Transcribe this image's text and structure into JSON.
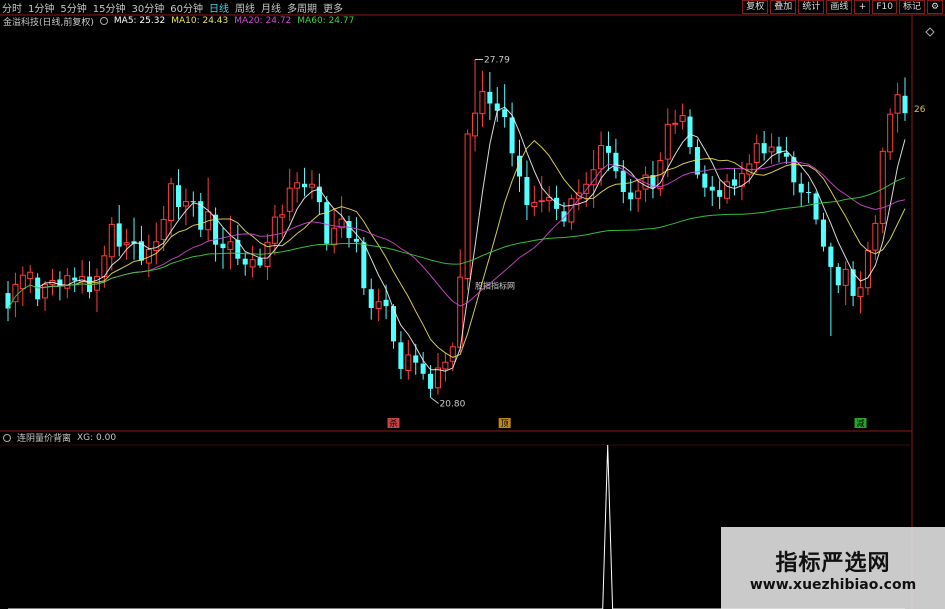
{
  "toolbar": {
    "tabs": [
      {
        "label": "分时",
        "active": false
      },
      {
        "label": "1分钟",
        "active": false
      },
      {
        "label": "5分钟",
        "active": false
      },
      {
        "label": "15分钟",
        "active": false
      },
      {
        "label": "30分钟",
        "active": false
      },
      {
        "label": "60分钟",
        "active": false
      },
      {
        "label": "日线",
        "active": true
      },
      {
        "label": "周线",
        "active": false
      },
      {
        "label": "月线",
        "active": false
      },
      {
        "label": "多周期",
        "active": false
      },
      {
        "label": "更多",
        "active": false
      }
    ],
    "tools": [
      "复权",
      "叠加",
      "统计",
      "画线",
      "F10",
      "标记"
    ],
    "icon_tools": [
      "plus-icon",
      "settings-icon"
    ]
  },
  "legend": {
    "title": "金溢科技(日线,前复权)",
    "ma5": "MA5: 25.32",
    "ma10": "MA10: 24.43",
    "ma20": "MA20: 24.72",
    "ma60": "MA60: 24.77"
  },
  "indicator": {
    "title": "连阴量价背离",
    "value": "XG: 0.00"
  },
  "watermark": {
    "cn": "指标严选网",
    "url": "www.xuezhibiao.com"
  },
  "colors": {
    "up": "#ff3b3b",
    "down": "#54ffff",
    "ma5": "#ffffff",
    "ma10": "#e8e05a",
    "ma20": "#d048d0",
    "ma60": "#3cd23c",
    "xg": "#ffffff"
  },
  "chart_data": {
    "type": "candlestick",
    "y_range": [
      20.5,
      28.4
    ],
    "high_label": "27.79",
    "low_label": "20.80",
    "right_price_label": "26",
    "annotation": "股指指标网",
    "markers": [
      {
        "index": 52,
        "label": "杀",
        "color": "#e05050"
      },
      {
        "index": 67,
        "label": "顶",
        "color": "#e0a020"
      },
      {
        "index": 115,
        "label": "减",
        "color": "#30c030"
      }
    ],
    "ohlc": [
      [
        22.96,
        23.21,
        22.38,
        22.64
      ],
      [
        22.78,
        23.38,
        22.46,
        23.14
      ],
      [
        23.05,
        23.51,
        22.69,
        23.33
      ],
      [
        23.26,
        23.54,
        22.96,
        23.39
      ],
      [
        23.28,
        23.37,
        22.69,
        22.83
      ],
      [
        22.86,
        23.21,
        22.59,
        23.14
      ],
      [
        23.14,
        23.46,
        22.91,
        23.22
      ],
      [
        23.24,
        23.41,
        22.81,
        23.1
      ],
      [
        23.06,
        23.48,
        22.85,
        23.32
      ],
      [
        23.28,
        23.49,
        22.98,
        23.22
      ],
      [
        23.2,
        23.64,
        22.95,
        23.3
      ],
      [
        23.3,
        23.62,
        22.85,
        22.98
      ],
      [
        23.02,
        23.47,
        22.57,
        23.3
      ],
      [
        23.3,
        23.94,
        23.07,
        23.73
      ],
      [
        23.71,
        24.53,
        23.43,
        24.38
      ],
      [
        24.4,
        24.78,
        23.72,
        23.92
      ],
      [
        23.96,
        24.29,
        23.65,
        24.0
      ],
      [
        24.03,
        24.52,
        23.65,
        23.98
      ],
      [
        24.03,
        24.35,
        23.54,
        23.63
      ],
      [
        23.58,
        24.17,
        23.29,
        23.86
      ],
      [
        23.84,
        24.42,
        23.55,
        24.02
      ],
      [
        24.07,
        24.76,
        23.83,
        24.48
      ],
      [
        24.46,
        25.35,
        24.14,
        25.22
      ],
      [
        25.19,
        25.52,
        24.49,
        24.74
      ],
      [
        24.76,
        25.12,
        24.36,
        24.85
      ],
      [
        24.86,
        25.06,
        24.54,
        24.84
      ],
      [
        24.86,
        25.03,
        24.12,
        24.27
      ],
      [
        24.27,
        25.35,
        24.04,
        24.64
      ],
      [
        24.58,
        24.73,
        23.61,
        23.96
      ],
      [
        23.98,
        24.31,
        23.46,
        23.89
      ],
      [
        23.86,
        24.56,
        23.45,
        24.02
      ],
      [
        24.06,
        24.37,
        23.54,
        23.67
      ],
      [
        23.67,
        23.8,
        23.32,
        23.55
      ],
      [
        23.5,
        23.94,
        23.28,
        23.65
      ],
      [
        23.68,
        23.88,
        23.48,
        23.53
      ],
      [
        23.51,
        24.18,
        23.23,
        24.01
      ],
      [
        23.99,
        24.78,
        23.75,
        24.53
      ],
      [
        24.53,
        24.79,
        24.11,
        24.58
      ],
      [
        24.65,
        25.53,
        24.45,
        25.13
      ],
      [
        25.13,
        25.46,
        24.83,
        25.24
      ],
      [
        25.22,
        25.55,
        24.96,
        25.15
      ],
      [
        25.15,
        25.5,
        24.9,
        25.21
      ],
      [
        25.16,
        25.43,
        24.58,
        24.84
      ],
      [
        24.84,
        24.97,
        23.84,
        23.98
      ],
      [
        23.96,
        24.72,
        23.78,
        24.3
      ],
      [
        24.31,
        24.96,
        24.1,
        24.49
      ],
      [
        24.45,
        24.56,
        23.9,
        24.1
      ],
      [
        24.08,
        24.53,
        23.8,
        24.02
      ],
      [
        24.01,
        24.12,
        22.92,
        23.06
      ],
      [
        23.04,
        23.26,
        22.41,
        22.65
      ],
      [
        22.64,
        23.05,
        22.38,
        22.78
      ],
      [
        22.82,
        23.13,
        22.42,
        22.69
      ],
      [
        22.69,
        22.73,
        21.81,
        21.96
      ],
      [
        21.94,
        22.17,
        21.18,
        21.39
      ],
      [
        21.36,
        21.99,
        21.17,
        21.68
      ],
      [
        21.67,
        21.91,
        21.27,
        21.52
      ],
      [
        21.5,
        21.74,
        21.17,
        21.29
      ],
      [
        21.29,
        21.47,
        20.8,
        20.98
      ],
      [
        21.0,
        21.72,
        20.86,
        21.41
      ],
      [
        21.39,
        21.72,
        21.13,
        21.53
      ],
      [
        21.55,
        21.94,
        21.34,
        21.85
      ],
      [
        21.84,
        23.86,
        21.73,
        23.29
      ],
      [
        23.26,
        26.34,
        23.02,
        26.25
      ],
      [
        26.21,
        27.79,
        25.89,
        26.68
      ],
      [
        26.67,
        27.56,
        26.39,
        27.13
      ],
      [
        27.12,
        27.53,
        26.54,
        26.88
      ],
      [
        26.88,
        27.22,
        26.5,
        26.73
      ],
      [
        26.76,
        27.28,
        26.38,
        26.6
      ],
      [
        26.59,
        26.9,
        25.58,
        25.85
      ],
      [
        25.8,
        26.13,
        25.05,
        25.37
      ],
      [
        25.36,
        25.7,
        24.47,
        24.78
      ],
      [
        24.75,
        25.18,
        24.55,
        24.83
      ],
      [
        24.85,
        25.38,
        24.63,
        24.87
      ],
      [
        24.87,
        25.17,
        24.64,
        24.94
      ],
      [
        24.93,
        25.18,
        24.47,
        24.7
      ],
      [
        24.65,
        24.84,
        24.33,
        24.44
      ],
      [
        24.43,
        25.0,
        24.27,
        24.91
      ],
      [
        24.91,
        25.31,
        24.67,
        25.03
      ],
      [
        25.02,
        25.46,
        24.74,
        25.21
      ],
      [
        25.2,
        25.92,
        24.72,
        25.51
      ],
      [
        25.53,
        26.3,
        25.18,
        26.01
      ],
      [
        26.0,
        26.3,
        25.49,
        25.86
      ],
      [
        25.86,
        26.15,
        25.33,
        25.48
      ],
      [
        25.49,
        25.71,
        24.82,
        25.05
      ],
      [
        25.04,
        25.32,
        24.66,
        24.9
      ],
      [
        24.92,
        25.31,
        24.64,
        25.07
      ],
      [
        25.11,
        25.58,
        24.84,
        25.4
      ],
      [
        25.4,
        25.69,
        24.92,
        25.14
      ],
      [
        25.12,
        25.87,
        24.97,
        25.7
      ],
      [
        25.73,
        26.78,
        25.35,
        26.45
      ],
      [
        26.46,
        26.75,
        26.25,
        26.47
      ],
      [
        26.51,
        26.88,
        26.34,
        26.63
      ],
      [
        26.61,
        26.76,
        25.83,
        25.98
      ],
      [
        25.98,
        26.14,
        25.33,
        25.41
      ],
      [
        25.43,
        25.6,
        24.95,
        25.14
      ],
      [
        25.16,
        25.38,
        24.76,
        25.08
      ],
      [
        25.09,
        25.29,
        24.7,
        24.95
      ],
      [
        24.92,
        25.42,
        24.81,
        25.26
      ],
      [
        25.31,
        25.55,
        24.98,
        25.18
      ],
      [
        25.17,
        25.67,
        24.88,
        25.43
      ],
      [
        25.42,
        25.83,
        25.22,
        25.63
      ],
      [
        25.66,
        26.24,
        25.45,
        26.05
      ],
      [
        26.06,
        26.31,
        25.7,
        25.85
      ],
      [
        25.88,
        26.26,
        25.63,
        25.98
      ],
      [
        25.99,
        26.19,
        25.66,
        25.85
      ],
      [
        25.86,
        26.19,
        25.63,
        25.78
      ],
      [
        25.77,
        25.89,
        24.98,
        25.25
      ],
      [
        25.22,
        25.45,
        24.74,
        25.04
      ],
      [
        25.05,
        25.26,
        24.82,
        25.03
      ],
      [
        25.02,
        25.06,
        24.38,
        24.48
      ],
      [
        24.48,
        24.62,
        23.82,
        23.92
      ],
      [
        23.92,
        24.0,
        22.07,
        23.5
      ],
      [
        23.5,
        23.58,
        22.96,
        23.12
      ],
      [
        23.12,
        23.62,
        22.71,
        23.45
      ],
      [
        23.45,
        23.62,
        22.69,
        22.9
      ],
      [
        22.89,
        23.41,
        22.54,
        23.07
      ],
      [
        23.07,
        24.02,
        22.92,
        23.84
      ],
      [
        23.85,
        24.57,
        23.64,
        24.4
      ],
      [
        24.4,
        25.97,
        24.2,
        25.89
      ],
      [
        25.88,
        26.78,
        25.71,
        26.66
      ],
      [
        26.68,
        27.31,
        26.28,
        27.06
      ],
      [
        27.04,
        27.42,
        26.52,
        26.68
      ]
    ],
    "xg": [
      0,
      0,
      0,
      0,
      0,
      0,
      0,
      0,
      0,
      0,
      0,
      0,
      0,
      0,
      0,
      0,
      0,
      0,
      0,
      0,
      0,
      0,
      0,
      0,
      0,
      0,
      0,
      0,
      0,
      0,
      0,
      0,
      0,
      0,
      0,
      0,
      0,
      0,
      0,
      0,
      0,
      0,
      0,
      0,
      0,
      0,
      0,
      0,
      0,
      0,
      0,
      0,
      0,
      0,
      0,
      0,
      0,
      0,
      0,
      0,
      0,
      0,
      0,
      0,
      0,
      0,
      0,
      0,
      0,
      0,
      0,
      0,
      0,
      0,
      0,
      0,
      0,
      0,
      0,
      0,
      0,
      0,
      0,
      0,
      0,
      0,
      0,
      0,
      0,
      0,
      0,
      0,
      0,
      0,
      0,
      0,
      0,
      0,
      0,
      0,
      0,
      0,
      0,
      0,
      0,
      0,
      0,
      0,
      0,
      0,
      0,
      0,
      0,
      0,
      0,
      0,
      0,
      0,
      0,
      0,
      0,
      1,
      0,
      0,
      0,
      0,
      0,
      0,
      0,
      0,
      0,
      0,
      0,
      0,
      0,
      0,
      0,
      0,
      0,
      0,
      0,
      0,
      0,
      0,
      0,
      0,
      0,
      0,
      0,
      0,
      0,
      0,
      0,
      0,
      0,
      0,
      0,
      0,
      0,
      0,
      0,
      0,
      0,
      0,
      0,
      0,
      0,
      0,
      0,
      0,
      0,
      0,
      0,
      0,
      0,
      0,
      0,
      0,
      0,
      0,
      0,
      0
    ]
  }
}
